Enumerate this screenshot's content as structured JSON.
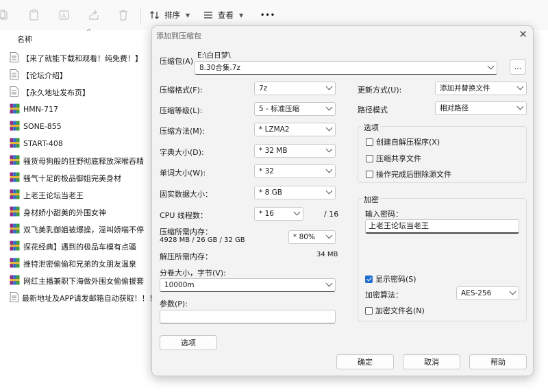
{
  "toolbar": {
    "sort_label": "排序",
    "view_label": "查看",
    "more_label": "•••"
  },
  "file_list": {
    "column_name": "名称",
    "items": [
      {
        "name": "【来了就能下载和观看！纯免费！】",
        "icon": "text-file-icon"
      },
      {
        "name": "【论坛介绍】",
        "icon": "text-file-icon"
      },
      {
        "name": "【永久地址发布页】",
        "icon": "text-file-icon"
      },
      {
        "name": "HMN-717",
        "icon": "archive-icon"
      },
      {
        "name": "SONE-855",
        "icon": "archive-icon"
      },
      {
        "name": "START-408",
        "icon": "archive-icon"
      },
      {
        "name": "骚货母狗般的狂野彻底释放深喉吞精",
        "icon": "archive-icon"
      },
      {
        "name": "骚气十足的极品御姐完美身材",
        "icon": "archive-icon"
      },
      {
        "name": "上老王论坛当老王",
        "icon": "archive-icon"
      },
      {
        "name": "身材娇小甜美的外围女神",
        "icon": "archive-icon"
      },
      {
        "name": "双飞美乳御姐被爆操，淫叫娇喘不停",
        "icon": "archive-icon"
      },
      {
        "name": "探花经典】遇到的极品车模有点骚",
        "icon": "archive-icon"
      },
      {
        "name": "推特泄密偷偷和兄弟的女朋友温泉",
        "icon": "archive-icon"
      },
      {
        "name": "网红主播兼职下海做外围女偷偷拔套",
        "icon": "archive-icon"
      },
      {
        "name": "最新地址及APP请发邮箱自动获取！！！",
        "icon": "text-file-icon"
      }
    ]
  },
  "dialog": {
    "title": "添加到压缩包",
    "archive_label": "压缩包(A)",
    "archive_path": "E:\\白日梦\\",
    "archive_name": "8.30合集.7z",
    "browse_label": "...",
    "format_label": "压缩格式(F):",
    "format_value": "7z",
    "level_label": "压缩等级(L):",
    "level_value": "5 - 标准压缩",
    "method_label": "压缩方法(M):",
    "method_value": "* LZMA2",
    "dict_label": "字典大小(D):",
    "dict_value": "* 32 MB",
    "word_label": "单词大小(W):",
    "word_value": "* 32",
    "solid_label": "固实数据大小：",
    "solid_value": "* 8 GB",
    "cpu_label": "CPU 线程数：",
    "cpu_value": "* 16",
    "cpu_max": "/ 16",
    "mem_comp_label": "压缩所需内存：",
    "mem_comp_value": "4928 MB / 26 GB / 32 GB",
    "mem_comp_pct": "* 80%",
    "mem_decomp_label": "解压所需内存：",
    "mem_decomp_value": "34 MB",
    "split_label": "分卷大小，字节(V):",
    "split_value": "10000m",
    "params_label": "参数(P):",
    "params_value": "",
    "options_button": "选项",
    "update_label": "更新方式(U):",
    "update_value": "添加并替换文件",
    "path_label": "路径模式",
    "path_value": "相对路径",
    "options_group": "选项",
    "opt_sfx": "创建自解压程序(X)",
    "opt_shared": "压缩共享文件",
    "opt_delete": "操作完成后删除源文件",
    "encrypt_group": "加密",
    "password_label": "输入密码：",
    "password_value": "上老王论坛当老王",
    "show_password": "显示密码(S)",
    "algo_label": "加密算法：",
    "algo_value": "AES-256",
    "encrypt_names": "加密文件名(N)",
    "ok_button": "确定",
    "cancel_button": "取消",
    "help_button": "帮助"
  }
}
